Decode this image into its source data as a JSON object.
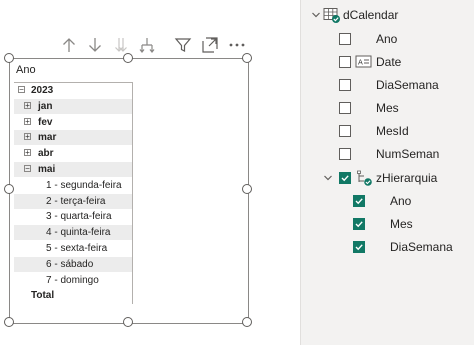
{
  "visual": {
    "title": "Ano",
    "toolbar": [
      {
        "name": "drill-up-icon"
      },
      {
        "name": "drill-down-icon"
      },
      {
        "name": "expand-next-level-icon"
      },
      {
        "name": "expand-all-icon"
      },
      {
        "name": "filter-icon"
      },
      {
        "name": "focus-mode-icon"
      },
      {
        "name": "more-options-icon"
      }
    ],
    "matrix": {
      "rows": [
        {
          "label": "2023",
          "expander": "minus",
          "bold": true,
          "shade": false
        },
        {
          "label": "jan",
          "expander": "plus",
          "bold": true,
          "shade": true
        },
        {
          "label": "fev",
          "expander": "plus",
          "bold": true,
          "shade": false
        },
        {
          "label": "mar",
          "expander": "plus",
          "bold": true,
          "shade": true
        },
        {
          "label": "abr",
          "expander": "plus",
          "bold": true,
          "shade": false
        },
        {
          "label": "mai",
          "expander": "minus",
          "bold": true,
          "shade": true
        },
        {
          "label": "1 - segunda-feira",
          "expander": "",
          "bold": false,
          "shade": false
        },
        {
          "label": "2 - terça-feira",
          "expander": "",
          "bold": false,
          "shade": true
        },
        {
          "label": "3 - quarta-feira",
          "expander": "",
          "bold": false,
          "shade": false
        },
        {
          "label": "4 - quinta-feira",
          "expander": "",
          "bold": false,
          "shade": true
        },
        {
          "label": "5 - sexta-feira",
          "expander": "",
          "bold": false,
          "shade": false
        },
        {
          "label": "6 - sábado",
          "expander": "",
          "bold": false,
          "shade": true
        },
        {
          "label": "7 - domingo",
          "expander": "",
          "bold": false,
          "shade": false
        },
        {
          "label": "Total",
          "expander": "",
          "bold": true,
          "shade": false
        }
      ]
    }
  },
  "fields": {
    "table_name": "dCalendar",
    "table_expanded": true,
    "table_checked_indicator": true,
    "items": [
      {
        "label": "Ano",
        "checked": false,
        "icon": ""
      },
      {
        "label": "Date",
        "checked": false,
        "icon": "date-field-icon"
      },
      {
        "label": "DiaSemana",
        "checked": false,
        "icon": ""
      },
      {
        "label": "Mes",
        "checked": false,
        "icon": ""
      },
      {
        "label": "MesId",
        "checked": false,
        "icon": ""
      },
      {
        "label": "NumSeman",
        "checked": false,
        "icon": ""
      }
    ],
    "hierarchy": {
      "label": "zHierarquia",
      "checked": true,
      "expanded": true,
      "levels": [
        {
          "label": "Ano",
          "checked": true
        },
        {
          "label": "Mes",
          "checked": true
        },
        {
          "label": "DiaSemana",
          "checked": true
        }
      ]
    }
  },
  "colors": {
    "accent": "#117865",
    "pane_background": "#f3f2f1",
    "row_shade": "#ececec",
    "border": "#8a8886"
  }
}
